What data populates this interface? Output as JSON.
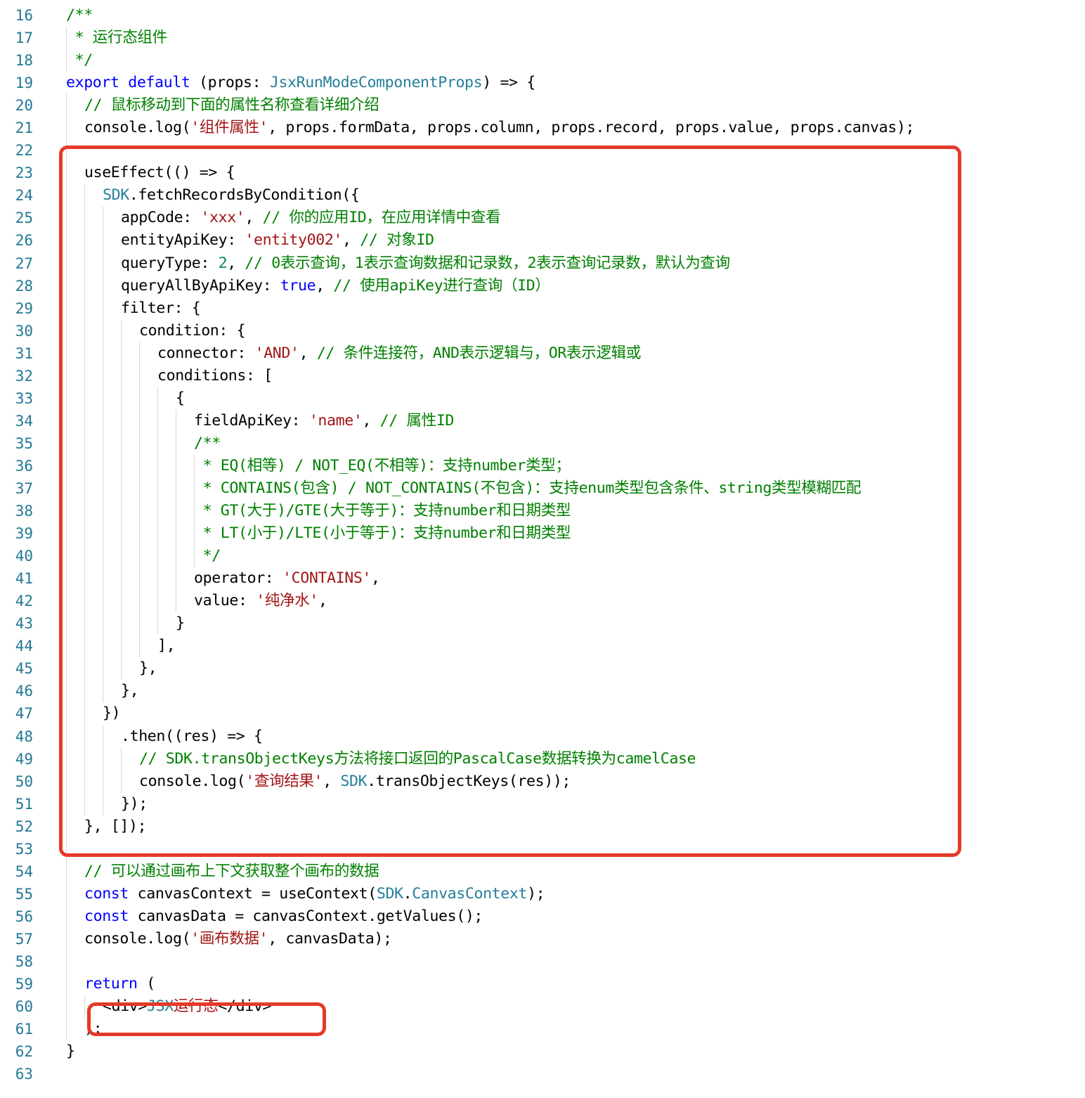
{
  "editor": {
    "language": "tsx",
    "colors": {
      "keyword": "#0000ff",
      "string": "#a31515",
      "comment": "#008000",
      "type": "#267f99",
      "number": "#098658",
      "line_number": "#237893",
      "highlight_box": "#e53a2a"
    },
    "lines": [
      {
        "n": "16",
        "indent": 0,
        "tokens": [
          {
            "t": "/**",
            "c": "cmt"
          }
        ]
      },
      {
        "n": "17",
        "indent": 0,
        "guides": [
          0
        ],
        "tokens": [
          {
            "t": " * 运行态组件",
            "c": "cmt"
          }
        ]
      },
      {
        "n": "18",
        "indent": 0,
        "guides": [
          0
        ],
        "tokens": [
          {
            "t": " */",
            "c": "cmt"
          }
        ]
      },
      {
        "n": "19",
        "indent": 0,
        "tokens": [
          {
            "t": "export",
            "c": "kw"
          },
          {
            "t": " ",
            "c": "pl"
          },
          {
            "t": "default",
            "c": "kw"
          },
          {
            "t": " (props: ",
            "c": "pl"
          },
          {
            "t": "JsxRunModeComponentProps",
            "c": "typ"
          },
          {
            "t": ") => {",
            "c": "pl"
          }
        ]
      },
      {
        "n": "20",
        "indent": 1,
        "guides": [
          0
        ],
        "tokens": [
          {
            "t": "// 鼠标移动到下面的属性名称查看详细介绍",
            "c": "cmt"
          }
        ]
      },
      {
        "n": "21",
        "indent": 1,
        "guides": [
          0
        ],
        "tokens": [
          {
            "t": "console.log(",
            "c": "pl"
          },
          {
            "t": "'组件属性'",
            "c": "str"
          },
          {
            "t": ", props.formData, props.column, props.record, props.value, props.canvas);",
            "c": "pl"
          }
        ]
      },
      {
        "n": "22",
        "indent": 1,
        "guides": [
          0
        ],
        "tokens": []
      },
      {
        "n": "23",
        "indent": 1,
        "guides": [
          0
        ],
        "tokens": [
          {
            "t": "useEffect(() => {",
            "c": "pl"
          }
        ]
      },
      {
        "n": "24",
        "indent": 2,
        "guides": [
          0,
          1
        ],
        "tokens": [
          {
            "t": "SDK",
            "c": "typ"
          },
          {
            "t": ".fetchRecordsByCondition({",
            "c": "pl"
          }
        ]
      },
      {
        "n": "25",
        "indent": 3,
        "guides": [
          0,
          1,
          2
        ],
        "tokens": [
          {
            "t": "appCode: ",
            "c": "pl"
          },
          {
            "t": "'xxx'",
            "c": "str"
          },
          {
            "t": ", ",
            "c": "pl"
          },
          {
            "t": "// 你的应用ID，在应用详情中查看",
            "c": "cmt"
          }
        ]
      },
      {
        "n": "26",
        "indent": 3,
        "guides": [
          0,
          1,
          2
        ],
        "tokens": [
          {
            "t": "entityApiKey: ",
            "c": "pl"
          },
          {
            "t": "'entity002'",
            "c": "str"
          },
          {
            "t": ", ",
            "c": "pl"
          },
          {
            "t": "// 对象ID",
            "c": "cmt"
          }
        ]
      },
      {
        "n": "27",
        "indent": 3,
        "guides": [
          0,
          1,
          2
        ],
        "tokens": [
          {
            "t": "queryType: ",
            "c": "pl"
          },
          {
            "t": "2",
            "c": "num"
          },
          {
            "t": ", ",
            "c": "pl"
          },
          {
            "t": "// 0表示查询，1表示查询数据和记录数，2表示查询记录数，默认为查询",
            "c": "cmt"
          }
        ]
      },
      {
        "n": "28",
        "indent": 3,
        "guides": [
          0,
          1,
          2
        ],
        "tokens": [
          {
            "t": "queryAllByApiKey: ",
            "c": "pl"
          },
          {
            "t": "true",
            "c": "kw"
          },
          {
            "t": ", ",
            "c": "pl"
          },
          {
            "t": "// 使用apiKey进行查询（ID）",
            "c": "cmt"
          }
        ]
      },
      {
        "n": "29",
        "indent": 3,
        "guides": [
          0,
          1,
          2
        ],
        "tokens": [
          {
            "t": "filter: {",
            "c": "pl"
          }
        ]
      },
      {
        "n": "30",
        "indent": 4,
        "guides": [
          0,
          1,
          2,
          3
        ],
        "tokens": [
          {
            "t": "condition: {",
            "c": "pl"
          }
        ]
      },
      {
        "n": "31",
        "indent": 5,
        "guides": [
          0,
          1,
          2,
          3,
          4
        ],
        "tokens": [
          {
            "t": "connector: ",
            "c": "pl"
          },
          {
            "t": "'AND'",
            "c": "str"
          },
          {
            "t": ", ",
            "c": "pl"
          },
          {
            "t": "// 条件连接符，AND表示逻辑与，OR表示逻辑或",
            "c": "cmt"
          }
        ]
      },
      {
        "n": "32",
        "indent": 5,
        "guides": [
          0,
          1,
          2,
          3,
          4
        ],
        "tokens": [
          {
            "t": "conditions: [",
            "c": "pl"
          }
        ]
      },
      {
        "n": "33",
        "indent": 6,
        "guides": [
          0,
          1,
          2,
          3,
          4,
          5
        ],
        "tokens": [
          {
            "t": "{",
            "c": "pl"
          }
        ]
      },
      {
        "n": "34",
        "indent": 7,
        "guides": [
          0,
          1,
          2,
          3,
          4,
          5,
          6
        ],
        "tokens": [
          {
            "t": "fieldApiKey: ",
            "c": "pl"
          },
          {
            "t": "'name'",
            "c": "str"
          },
          {
            "t": ", ",
            "c": "pl"
          },
          {
            "t": "// 属性ID",
            "c": "cmt"
          }
        ]
      },
      {
        "n": "35",
        "indent": 7,
        "guides": [
          0,
          1,
          2,
          3,
          4,
          5,
          6
        ],
        "tokens": [
          {
            "t": "/**",
            "c": "cmt"
          }
        ]
      },
      {
        "n": "36",
        "indent": 7,
        "guides": [
          0,
          1,
          2,
          3,
          4,
          5,
          6,
          7
        ],
        "tokens": [
          {
            "t": " * EQ(相等) / NOT_EQ(不相等)：支持number类型；",
            "c": "cmt"
          }
        ]
      },
      {
        "n": "37",
        "indent": 7,
        "guides": [
          0,
          1,
          2,
          3,
          4,
          5,
          6,
          7
        ],
        "tokens": [
          {
            "t": " * CONTAINS(包含) / NOT_CONTAINS(不包含)：支持enum类型包含条件、string类型模糊匹配",
            "c": "cmt"
          }
        ]
      },
      {
        "n": "38",
        "indent": 7,
        "guides": [
          0,
          1,
          2,
          3,
          4,
          5,
          6,
          7
        ],
        "tokens": [
          {
            "t": " * GT(大于)/GTE(大于等于)：支持number和日期类型",
            "c": "cmt"
          }
        ]
      },
      {
        "n": "39",
        "indent": 7,
        "guides": [
          0,
          1,
          2,
          3,
          4,
          5,
          6,
          7
        ],
        "tokens": [
          {
            "t": " * LT(小于)/LTE(小于等于)：支持number和日期类型",
            "c": "cmt"
          }
        ]
      },
      {
        "n": "40",
        "indent": 7,
        "guides": [
          0,
          1,
          2,
          3,
          4,
          5,
          6,
          7
        ],
        "tokens": [
          {
            "t": " */",
            "c": "cmt"
          }
        ]
      },
      {
        "n": "41",
        "indent": 7,
        "guides": [
          0,
          1,
          2,
          3,
          4,
          5,
          6
        ],
        "tokens": [
          {
            "t": "operator: ",
            "c": "pl"
          },
          {
            "t": "'CONTAINS'",
            "c": "str"
          },
          {
            "t": ",",
            "c": "pl"
          }
        ]
      },
      {
        "n": "42",
        "indent": 7,
        "guides": [
          0,
          1,
          2,
          3,
          4,
          5,
          6
        ],
        "tokens": [
          {
            "t": "value: ",
            "c": "pl"
          },
          {
            "t": "'纯净水'",
            "c": "str"
          },
          {
            "t": ",",
            "c": "pl"
          }
        ]
      },
      {
        "n": "43",
        "indent": 6,
        "guides": [
          0,
          1,
          2,
          3,
          4,
          5
        ],
        "tokens": [
          {
            "t": "}",
            "c": "pl"
          }
        ]
      },
      {
        "n": "44",
        "indent": 5,
        "guides": [
          0,
          1,
          2,
          3,
          4
        ],
        "tokens": [
          {
            "t": "],",
            "c": "pl"
          }
        ]
      },
      {
        "n": "45",
        "indent": 4,
        "guides": [
          0,
          1,
          2,
          3
        ],
        "tokens": [
          {
            "t": "},",
            "c": "pl"
          }
        ]
      },
      {
        "n": "46",
        "indent": 3,
        "guides": [
          0,
          1,
          2
        ],
        "tokens": [
          {
            "t": "},",
            "c": "pl"
          }
        ]
      },
      {
        "n": "47",
        "indent": 2,
        "guides": [
          0,
          1
        ],
        "tokens": [
          {
            "t": "})",
            "c": "pl"
          }
        ]
      },
      {
        "n": "48",
        "indent": 3,
        "guides": [
          0,
          1,
          2
        ],
        "tokens": [
          {
            "t": ".then((res) => {",
            "c": "pl"
          }
        ]
      },
      {
        "n": "49",
        "indent": 4,
        "guides": [
          0,
          1,
          2,
          3
        ],
        "tokens": [
          {
            "t": "// SDK.transObjectKeys方法将接口返回的PascalCase数据转换为camelCase",
            "c": "cmt"
          }
        ]
      },
      {
        "n": "50",
        "indent": 4,
        "guides": [
          0,
          1,
          2,
          3
        ],
        "tokens": [
          {
            "t": "console.log(",
            "c": "pl"
          },
          {
            "t": "'查询结果'",
            "c": "str"
          },
          {
            "t": ", ",
            "c": "pl"
          },
          {
            "t": "SDK",
            "c": "typ"
          },
          {
            "t": ".transObjectKeys(res));",
            "c": "pl"
          }
        ]
      },
      {
        "n": "51",
        "indent": 3,
        "guides": [
          0,
          1,
          2
        ],
        "tokens": [
          {
            "t": "});",
            "c": "pl"
          }
        ]
      },
      {
        "n": "52",
        "indent": 1,
        "guides": [
          0
        ],
        "tokens": [
          {
            "t": "}, []);",
            "c": "pl"
          }
        ]
      },
      {
        "n": "53",
        "indent": 1,
        "guides": [
          0
        ],
        "tokens": []
      },
      {
        "n": "54",
        "indent": 1,
        "guides": [
          0
        ],
        "tokens": [
          {
            "t": "// 可以通过画布上下文获取整个画布的数据",
            "c": "cmt"
          }
        ]
      },
      {
        "n": "55",
        "indent": 1,
        "guides": [
          0
        ],
        "tokens": [
          {
            "t": "const",
            "c": "kw"
          },
          {
            "t": " canvasContext = useContext(",
            "c": "pl"
          },
          {
            "t": "SDK",
            "c": "typ"
          },
          {
            "t": ".",
            "c": "pl"
          },
          {
            "t": "CanvasContext",
            "c": "typ"
          },
          {
            "t": ");",
            "c": "pl"
          }
        ]
      },
      {
        "n": "56",
        "indent": 1,
        "guides": [
          0
        ],
        "tokens": [
          {
            "t": "const",
            "c": "kw"
          },
          {
            "t": " canvasData = canvasContext.getValues();",
            "c": "pl"
          }
        ]
      },
      {
        "n": "57",
        "indent": 1,
        "guides": [
          0
        ],
        "tokens": [
          {
            "t": "console.log(",
            "c": "pl"
          },
          {
            "t": "'画布数据'",
            "c": "str"
          },
          {
            "t": ", canvasData);",
            "c": "pl"
          }
        ]
      },
      {
        "n": "58",
        "indent": 1,
        "guides": [
          0
        ],
        "tokens": []
      },
      {
        "n": "59",
        "indent": 1,
        "guides": [
          0
        ],
        "tokens": [
          {
            "t": "return",
            "c": "kw"
          },
          {
            "t": " (",
            "c": "pl"
          }
        ]
      },
      {
        "n": "60",
        "indent": 2,
        "guides": [
          0,
          1
        ],
        "tokens": [
          {
            "t": "<div>",
            "c": "pl"
          },
          {
            "t": "JSX",
            "c": "typ"
          },
          {
            "t": "运行态",
            "c": "str"
          },
          {
            "t": "</div>",
            "c": "pl"
          }
        ]
      },
      {
        "n": "61",
        "indent": 1,
        "guides": [
          0
        ],
        "tokens": [
          {
            "t": ");",
            "c": "pl"
          }
        ]
      },
      {
        "n": "62",
        "indent": 0,
        "tokens": [
          {
            "t": "}",
            "c": "pl"
          }
        ]
      },
      {
        "n": "63",
        "indent": 0,
        "tokens": []
      }
    ]
  }
}
